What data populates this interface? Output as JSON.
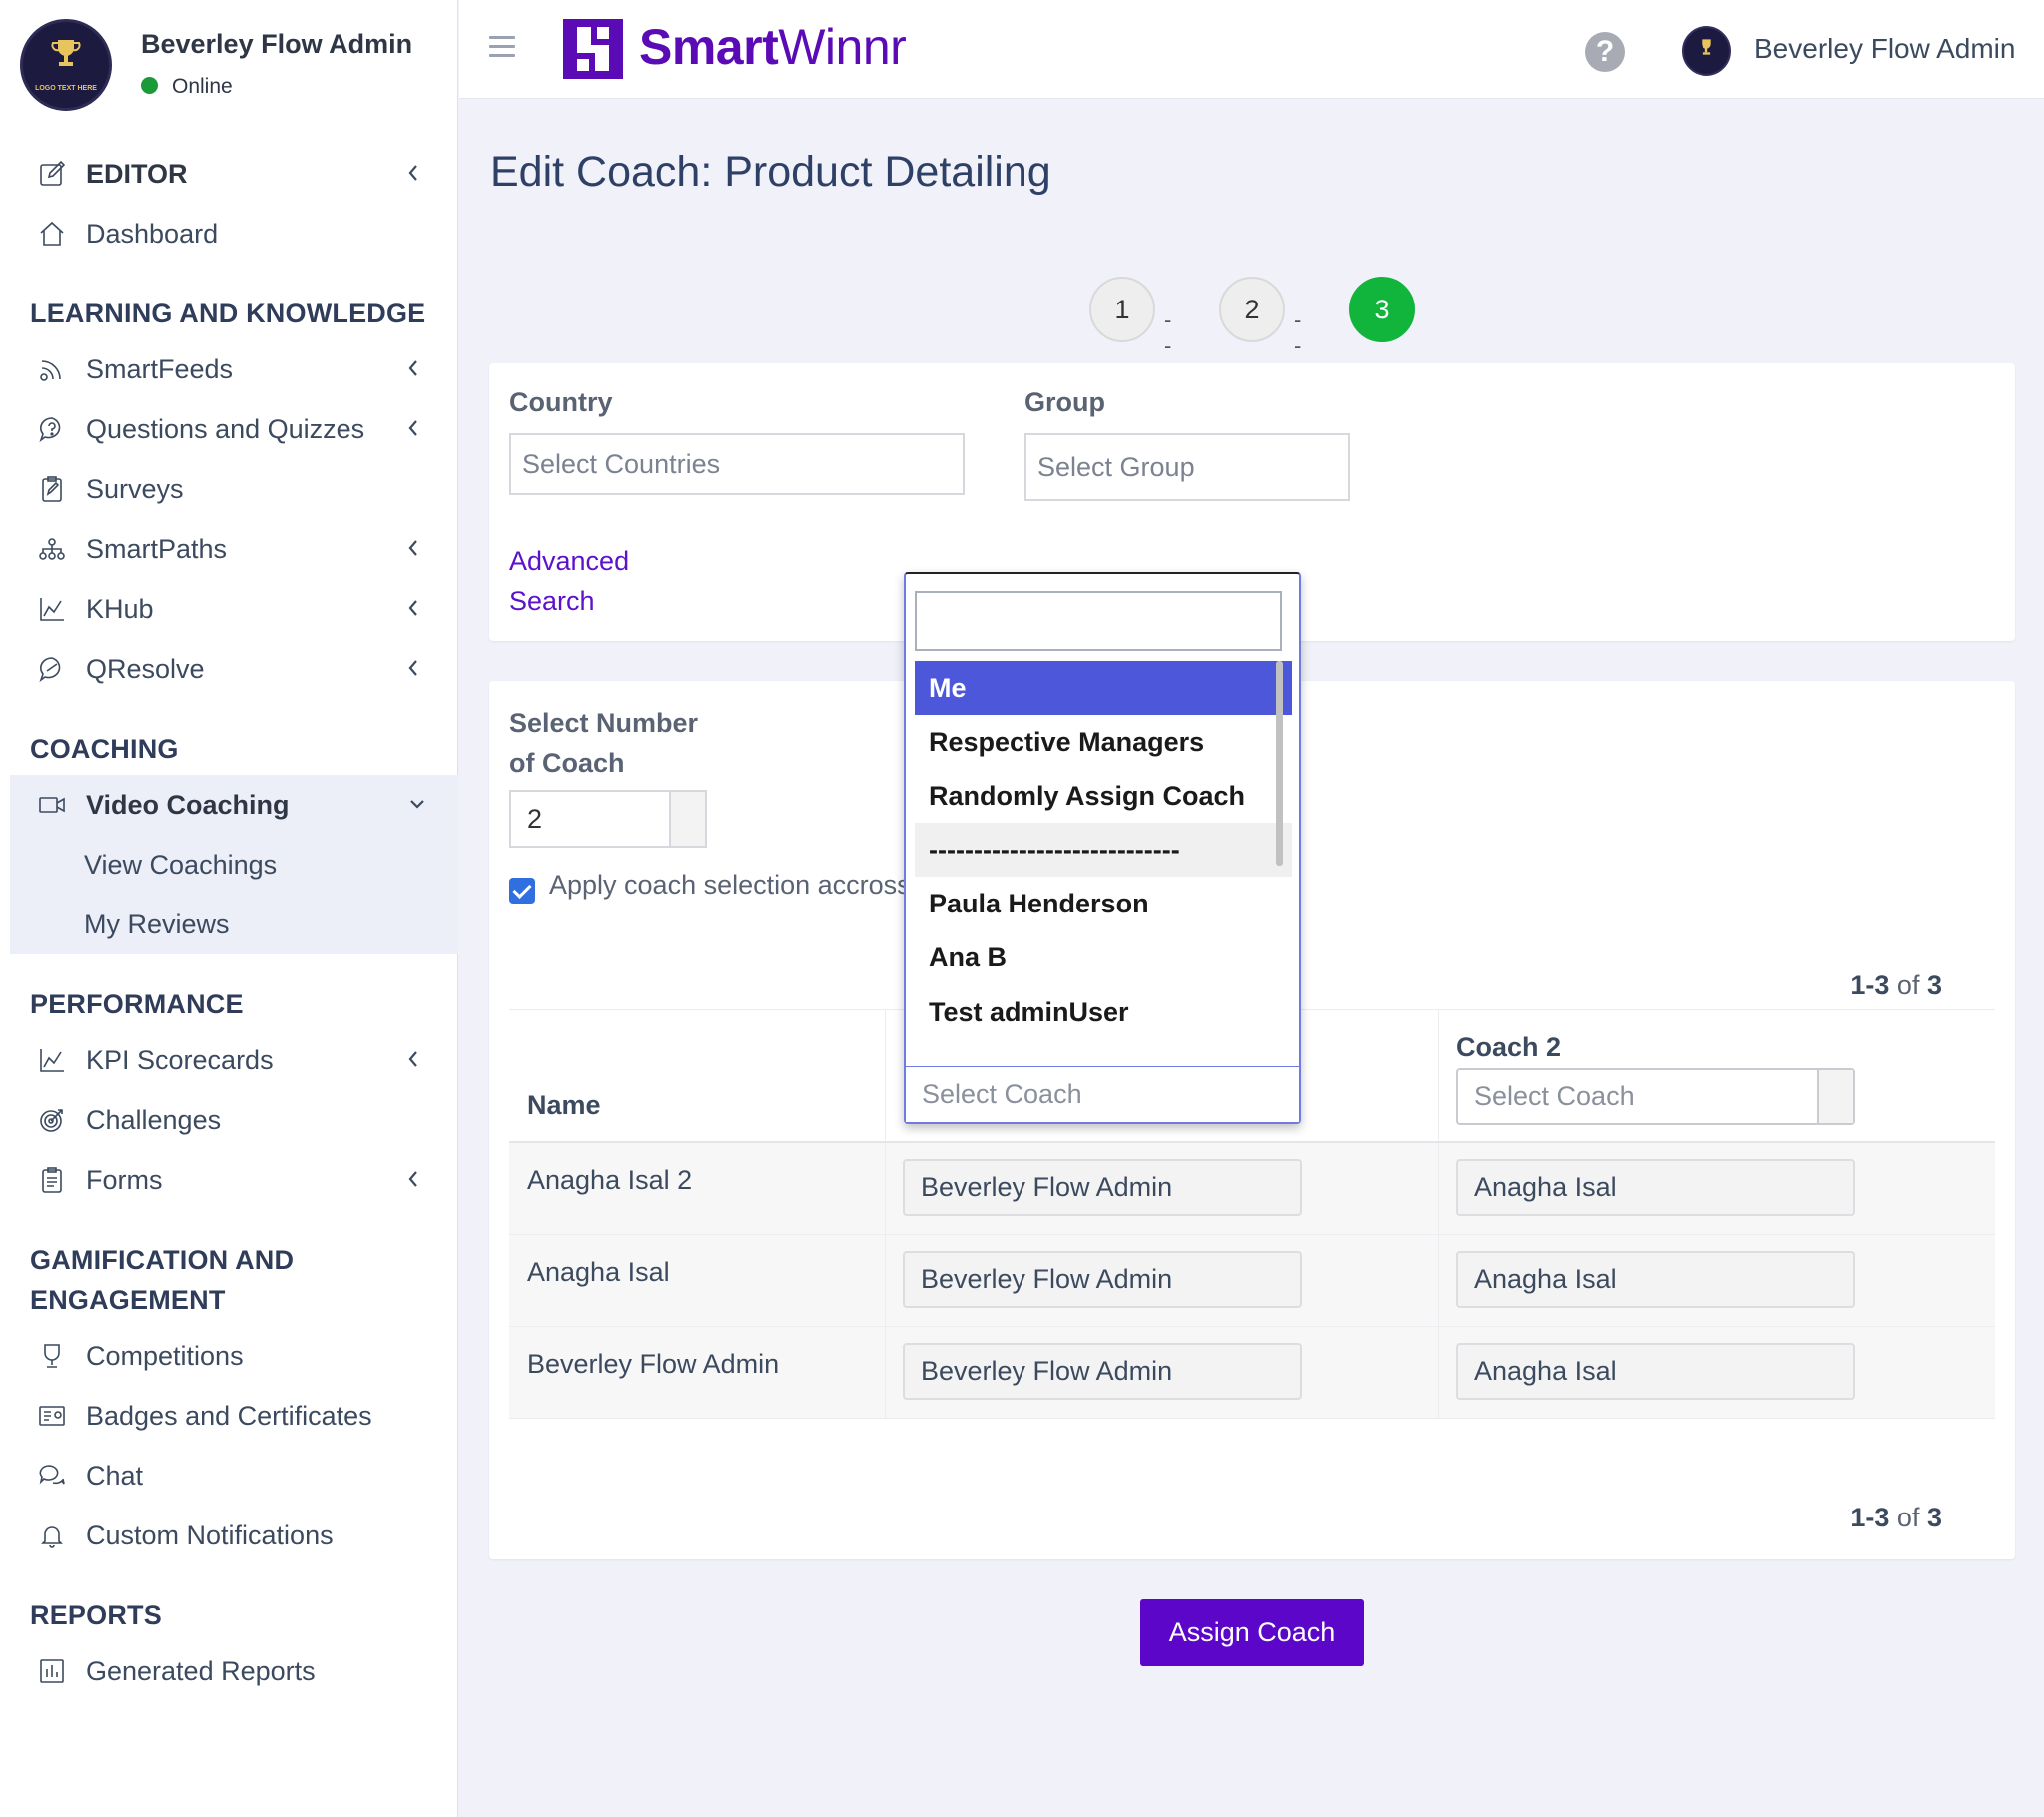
{
  "user": {
    "name": "Beverley Flow Admin",
    "status": "Online",
    "logo_text": "LOGO TEXT HERE"
  },
  "sidebar": {
    "editor_label": "EDITOR",
    "dashboard_label": "Dashboard",
    "sections": {
      "learning": "LEARNING AND KNOWLEDGE",
      "coaching": "COACHING",
      "performance": "PERFORMANCE",
      "gamification_line1": "GAMIFICATION AND",
      "gamification_line2": "ENGAGEMENT",
      "reports": "REPORTS"
    },
    "learning_items": [
      {
        "label": "SmartFeeds",
        "icon": "feed-icon"
      },
      {
        "label": "Questions and Quizzes",
        "icon": "question-bubble-icon"
      },
      {
        "label": "Surveys",
        "icon": "clipboard-icon"
      },
      {
        "label": "SmartPaths",
        "icon": "hierarchy-icon"
      },
      {
        "label": "KHub",
        "icon": "line-chart-icon"
      },
      {
        "label": "QResolve",
        "icon": "chat-bubble-icon"
      }
    ],
    "coaching_items": {
      "video_coaching": "Video Coaching",
      "view_coachings": "View Coachings",
      "my_reviews": "My Reviews"
    },
    "performance_items": [
      {
        "label": "KPI Scorecards",
        "icon": "line-chart-icon"
      },
      {
        "label": "Challenges",
        "icon": "target-icon"
      },
      {
        "label": "Forms",
        "icon": "form-icon"
      }
    ],
    "gamification_items": [
      {
        "label": "Competitions",
        "icon": "trophy-icon"
      },
      {
        "label": "Badges and Certificates",
        "icon": "certificate-icon"
      },
      {
        "label": "Chat",
        "icon": "chat-icon"
      },
      {
        "label": "Custom Notifications",
        "icon": "bell-icon"
      }
    ],
    "reports_items": [
      {
        "label": "Generated Reports",
        "icon": "bar-chart-icon"
      }
    ]
  },
  "topbar": {
    "brand_bold": "Smart",
    "brand_light": "Winnr",
    "help_glyph": "?",
    "user_name": "Beverley Flow Admin"
  },
  "page": {
    "title": "Edit Coach: Product Detailing",
    "steps": [
      "1",
      "2",
      "3"
    ],
    "step_separator": "-----",
    "active_step": 3
  },
  "filters": {
    "country_label": "Country",
    "country_placeholder": "Select Countries",
    "group_label": "Group",
    "group_placeholder": "Select Group",
    "advanced_search_line1": "Advanced",
    "advanced_search_line2": "Search"
  },
  "coach_config": {
    "number_label_line1": "Select Number",
    "number_label_line2": "of Coach",
    "number_value": "2",
    "apply_label": "Apply coach selection accross all rows",
    "apply_checked": true
  },
  "pagination": {
    "range": "1-3",
    "of_text": "of",
    "total": "3"
  },
  "table": {
    "name_header": "Name",
    "coach2_header": "Coach 2",
    "select_coach_placeholder": "Select Coach",
    "rows": [
      {
        "name": "Anagha Isal 2",
        "coach1": "Beverley Flow Admin",
        "coach2": "Anagha Isal"
      },
      {
        "name": "Anagha Isal",
        "coach1": "Beverley Flow Admin",
        "coach2": "Anagha Isal"
      },
      {
        "name": "Beverley Flow Admin",
        "coach1": "Beverley Flow Admin",
        "coach2": "Anagha Isal"
      }
    ]
  },
  "dropdown": {
    "search_value": "",
    "options": [
      "Me",
      "Respective Managers",
      "Randomly Assign Coach",
      "----------------------------",
      "Paula Henderson",
      "Ana B",
      "Test adminUser adminUser"
    ],
    "highlighted": "Me"
  },
  "assign_button": "Assign Coach",
  "colors": {
    "brand": "#5b0bb5",
    "active_step": "#12b53c",
    "highlight": "#4c57d9",
    "online": "#1a9b38"
  }
}
